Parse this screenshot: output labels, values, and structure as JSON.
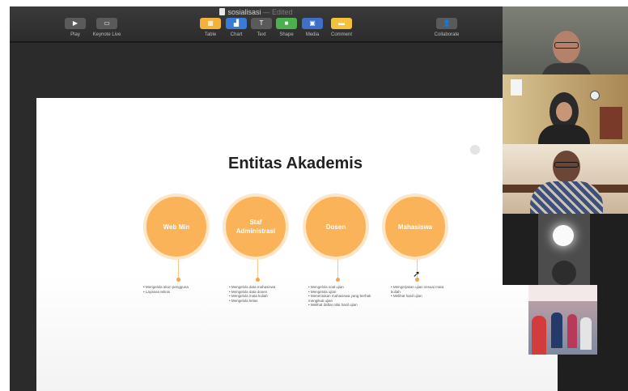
{
  "window": {
    "doc_title": "sosialisasi",
    "status": "— Edited"
  },
  "toolbar": {
    "buttons": [
      {
        "label": "Play",
        "icon": "play-icon",
        "glyph": "▶"
      },
      {
        "label": "Keynote Live",
        "icon": "keynote-live-icon",
        "glyph": "▭"
      },
      {
        "label": "Table",
        "icon": "table-icon",
        "glyph": "▦"
      },
      {
        "label": "Chart",
        "icon": "chart-icon",
        "glyph": "▟"
      },
      {
        "label": "Text",
        "icon": "text-icon",
        "glyph": "T"
      },
      {
        "label": "Shape",
        "icon": "shape-icon",
        "glyph": "■"
      },
      {
        "label": "Media",
        "icon": "media-icon",
        "glyph": "▣"
      },
      {
        "label": "Comment",
        "icon": "comment-icon",
        "glyph": "▬"
      },
      {
        "label": "Collaborate",
        "icon": "collaborate-icon",
        "glyph": "👤"
      }
    ],
    "colors": {
      "table": "#f2b23c",
      "chart": "#3a7bd5",
      "shape": "#4caf50",
      "comment": "#f2c23c"
    }
  },
  "slide": {
    "title": "Entitas Akademis",
    "accent": "#fbb35a",
    "entities": [
      {
        "name": "Web Min",
        "items": [
          "Mengelola akun pengguna",
          "Layanan teknis"
        ]
      },
      {
        "name": "Staf Administrasi",
        "items": [
          "Mengelola data mahasiswa",
          "Mengelola data dosen",
          "Mengelola mata kuliah",
          "Mengelola kelas"
        ]
      },
      {
        "name": "Dosen",
        "items": [
          "Mengelola soal ujian",
          "Mengelola ujian",
          "Menentukan mahasiswa yang berhak mengikuti ujian",
          "Melihat daftar nilai hasil ujian"
        ]
      },
      {
        "name": "Mahasiswa",
        "items": [
          "Mengerjakan ujian sesuai mata kuliah",
          "Melihat hasil ujian"
        ]
      }
    ]
  },
  "participants": [
    {
      "name": "participant-1"
    },
    {
      "name": "participant-2"
    },
    {
      "name": "participant-3"
    },
    {
      "name": "participant-4"
    },
    {
      "name": "participant-5"
    }
  ]
}
